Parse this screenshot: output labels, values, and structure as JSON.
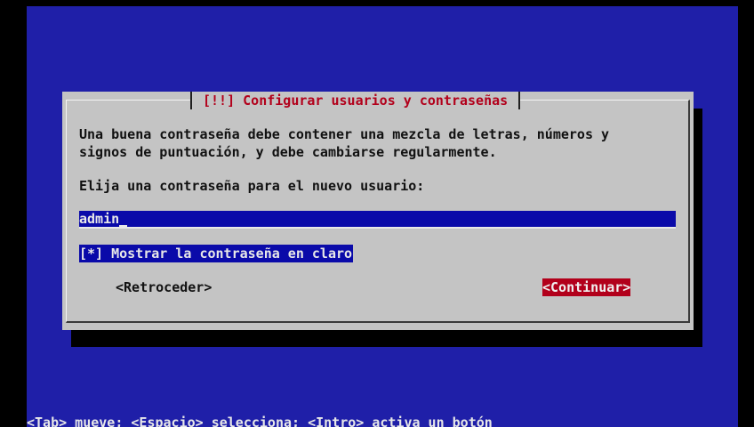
{
  "colors": {
    "screen_background": "#1f1fa8",
    "dialog_background": "#c4c4c4",
    "title_text": "#b2001b",
    "selected_field": "#0a0aa9",
    "focused_button": "#b2001b"
  },
  "dialog": {
    "title": "[!!] Configurar usuarios y contraseñas",
    "description_line1": "Una buena contraseña debe contener una mezcla de letras, números y",
    "description_line2": "signos de puntuación, y debe cambiarse regularmente.",
    "prompt": "Elija una contraseña para el nuevo usuario:",
    "password_value": "admin",
    "show_password_checkbox": "[*] Mostrar la contraseña en claro",
    "back_button": "<Retroceder>",
    "continue_button": "<Continuar>"
  },
  "help_bar": {
    "text": "<Tab> mueve; <Espacio> selecciona; <Intro> activa un botón"
  }
}
